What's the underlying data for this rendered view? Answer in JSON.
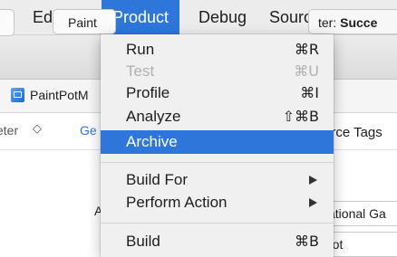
{
  "menubar": {
    "items": [
      "e",
      "Editor",
      "Product",
      "Debug",
      "Source Control"
    ]
  },
  "window": {
    "scheme_label": "Paint",
    "status_prefix": "ter: ",
    "status_value": "Succe",
    "project_name": "PaintPotM",
    "filter_text": "eter",
    "filter_chevron": "◇",
    "tab_label": "Ge",
    "source_tags_label": "urce Tags",
    "label_a": "A",
    "field1_value": "cational Ga",
    "field2_value": "tpot"
  },
  "product_menu": {
    "items": [
      {
        "label": "Run",
        "shortcut": "⌘R",
        "enabled": true
      },
      {
        "label": "Test",
        "shortcut": "⌘U",
        "enabled": false
      },
      {
        "label": "Profile",
        "shortcut": "⌘I",
        "enabled": true
      },
      {
        "label": "Analyze",
        "shortcut": "⇧⌘B",
        "enabled": true
      },
      {
        "label": "Archive",
        "shortcut": "",
        "enabled": true,
        "highlighted": true
      },
      {
        "label": "Build For",
        "submenu": true
      },
      {
        "label": "Perform Action",
        "submenu": true
      },
      {
        "label": "Build",
        "shortcut": "⌘B",
        "enabled": true
      }
    ]
  },
  "colors": {
    "highlight": "#2f76db",
    "menu_bg": "#f0f0f0",
    "menubar_bg": "#ececec"
  }
}
